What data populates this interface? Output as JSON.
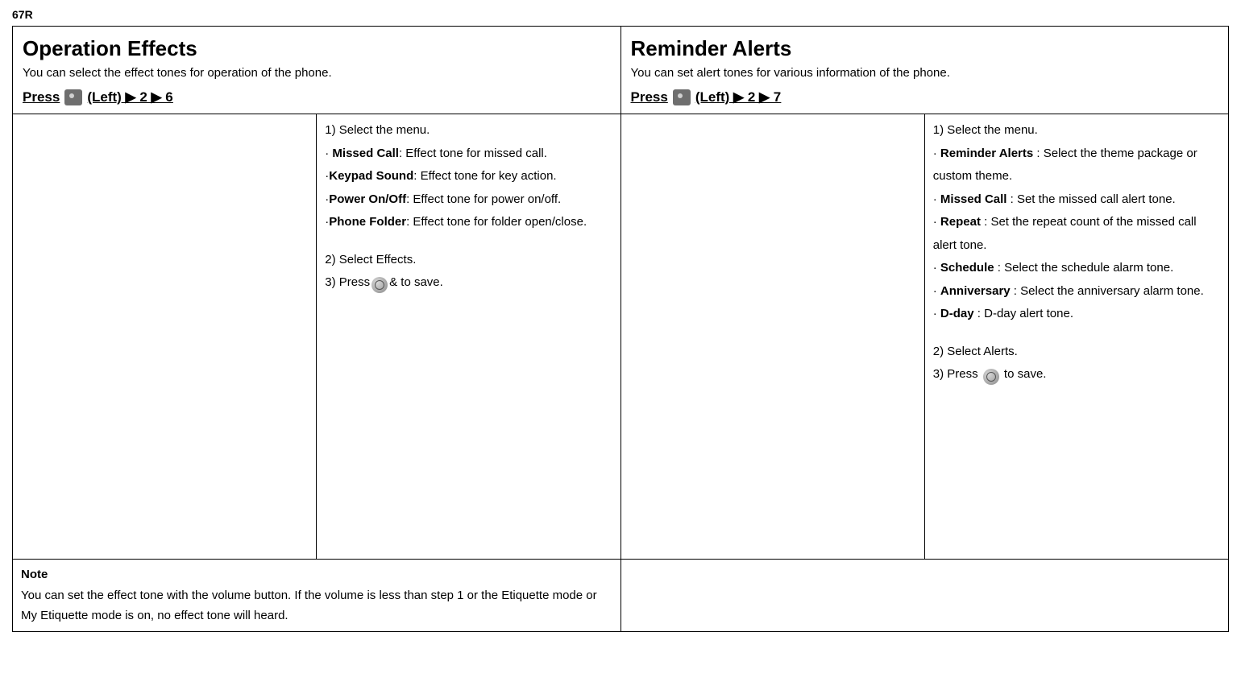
{
  "page_code": "67R",
  "left": {
    "title": "Operation Effects",
    "desc": "You can select the effect tones for operation of the phone.",
    "press_prefix": "Press",
    "press_suffix": "(Left) ▶ 2 ▶ 6",
    "step1_intro": "1) Select the menu.",
    "items": [
      {
        "label": "Missed Call",
        "desc": ": Effect tone for missed call."
      },
      {
        "label": "Keypad Sound",
        "desc": ": Effect tone for key action."
      },
      {
        "label": "Power On/Off",
        "desc": ": Effect tone for power on/off."
      },
      {
        "label": "Phone Folder",
        "desc": ": Effect tone for folder open/close."
      }
    ],
    "step2": "2) Select Effects.",
    "step3_pre": "3) Press",
    "step3_post": "& to save."
  },
  "right": {
    "title": "Reminder Alerts",
    "desc": "You can set alert tones for various information of the phone.",
    "press_prefix": "Press",
    "press_suffix": "(Left) ▶ 2 ▶ 7",
    "step1_intro": "1) Select the menu.",
    "items": [
      {
        "label": "Reminder Alerts",
        "desc": " : Select the theme package or custom theme."
      },
      {
        "label": "Missed Call",
        "desc": " : Set the missed call alert tone."
      },
      {
        "label": "Repeat",
        "desc": " : Set the repeat count of the missed call alert tone."
      },
      {
        "label": "Schedule",
        "desc": " : Select the schedule alarm tone."
      },
      {
        "label": "Anniversary",
        "desc": " : Select the anniversary alarm tone."
      },
      {
        "label": "D-day",
        "desc": " : D-day alert tone."
      }
    ],
    "step2": "2) Select Alerts.",
    "step3_pre": "3) Press ",
    "step3_post": " to save."
  },
  "note": {
    "label": "Note",
    "text": "You can set the effect tone with the volume button. If the volume is less than step 1 or the Etiquette mode or My Etiquette mode is on, no effect tone will heard."
  }
}
